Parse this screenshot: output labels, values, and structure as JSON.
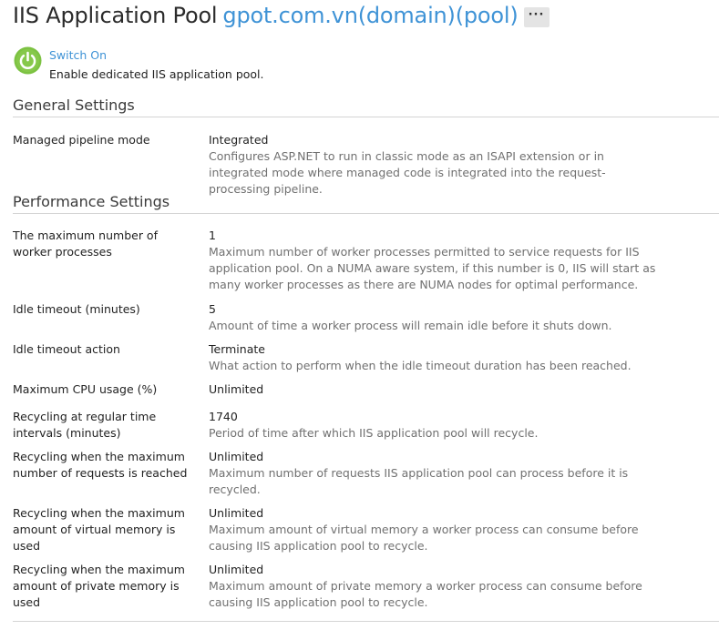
{
  "header": {
    "title": "IIS Application Pool",
    "pool_name": "gpot.com.vn(domain)(pool)",
    "more_label": "···"
  },
  "status": {
    "toggle_label": "Switch On",
    "description": "Enable dedicated IIS application pool.",
    "icon": "power-icon",
    "icon_color": "#7cc242"
  },
  "general": {
    "heading": "General Settings",
    "settings": [
      {
        "label": "Managed pipeline mode",
        "value": "Integrated",
        "hint": "Configures ASP.NET to run in classic mode as an ISAPI extension or in integrated mode where managed code is integrated into the request-processing pipeline."
      }
    ]
  },
  "performance": {
    "heading": "Performance Settings",
    "settings": [
      {
        "label": "The maximum number of worker processes",
        "value": "1",
        "hint": "Maximum number of worker processes permitted to service requests for IIS application pool. On a NUMA aware system, if this number is 0, IIS will start as many worker processes as there are NUMA nodes for optimal performance."
      },
      {
        "label": "Idle timeout (minutes)",
        "value": "5",
        "hint": "Amount of time a worker process will remain idle before it shuts down."
      },
      {
        "label": "Idle timeout action",
        "value": "Terminate",
        "hint": "What action to perform when the idle timeout duration has been reached."
      },
      {
        "label": "Maximum CPU usage (%)",
        "value": "Unlimited",
        "hint": ""
      },
      {
        "label": "Recycling at regular time intervals (minutes)",
        "value": "1740",
        "hint": "Period of time after which IIS application pool will recycle."
      },
      {
        "label": "Recycling when the maximum number of requests is reached",
        "value": "Unlimited",
        "hint": "Maximum number of requests IIS application pool can process before it is recycled."
      },
      {
        "label": "Recycling when the maximum amount of virtual memory is used",
        "value": "Unlimited",
        "hint": "Maximum amount of virtual memory a worker process can consume before causing IIS application pool to recycle."
      },
      {
        "label": "Recycling when the maximum amount of private memory is used",
        "value": "Unlimited",
        "hint": "Maximum amount of private memory a worker process can consume before causing IIS application pool to recycle."
      }
    ]
  }
}
